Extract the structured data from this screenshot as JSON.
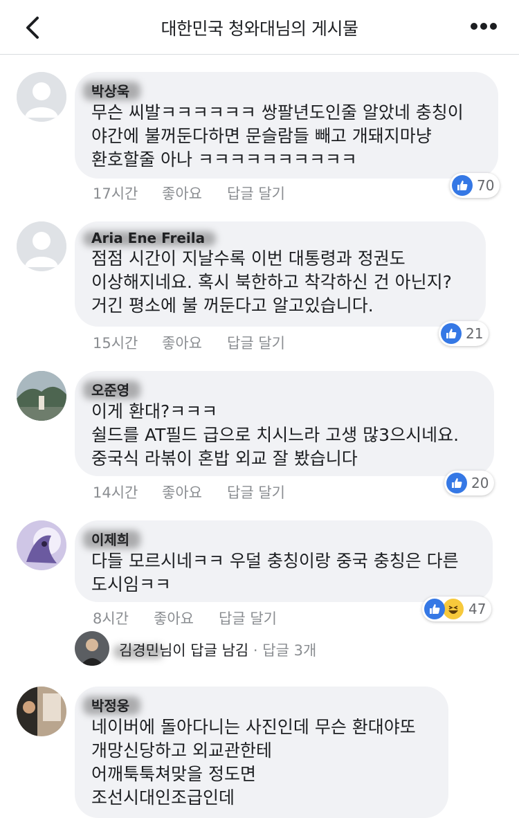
{
  "header": {
    "title": "대한민국 청와대님의 게시물"
  },
  "comments": [
    {
      "author": "박상욱",
      "lines": [
        "무슨 씨발ㅋㅋㅋㅋㅋㅋ 쌍팔년도인줄 알았네 충칭이",
        "야간에 불꺼둔다하면 문슬람들 빼고 개돼지마냥",
        "환호할줄 아나 ㅋㅋㅋㅋㅋㅋㅋㅋㅋㅋ"
      ],
      "time": "17시간",
      "like_label": "좋아요",
      "reply_label": "답글 달기",
      "reaction_count": "70",
      "reactions": [
        "like-icon"
      ]
    },
    {
      "author": "Aria Ene Freila",
      "lines": [
        "점점 시간이 지날수록 이번 대통령과 정권도",
        "이상해지네요. 혹시 북한하고 착각하신 건 아닌지?",
        "거긴 평소에 불 꺼둔다고 알고있습니다."
      ],
      "time": "15시간",
      "like_label": "좋아요",
      "reply_label": "답글 달기",
      "reaction_count": "21",
      "reactions": [
        "like-icon"
      ]
    },
    {
      "author": "오준영",
      "lines": [
        "이게 환대?ㅋㅋㅋ",
        "쉴드를 AT필드 급으로 치시느라 고생 많3으시네요.",
        "중국식 라볶이 혼밥 외교 잘 봤습니다"
      ],
      "time": "14시간",
      "like_label": "좋아요",
      "reply_label": "답글 달기",
      "reaction_count": "20",
      "reactions": [
        "like-icon"
      ]
    },
    {
      "author": "이제희",
      "lines": [
        "다들 모르시네ㅋㅋ 우덜 충칭이랑 중국 충칭은 다른",
        "도시임ㅋㅋ"
      ],
      "time": "8시간",
      "like_label": "좋아요",
      "reply_label": "답글 달기",
      "reaction_count": "47",
      "reactions": [
        "like-icon",
        "haha-icon"
      ]
    },
    {
      "author": "박정웅",
      "lines": [
        "네이버에 돌아다니는 사진인데 무슨 환대야또",
        "개망신당하고 외교관한테",
        "어깨툭툭쳐맞을 정도면",
        "조선시대인조급인데"
      ]
    }
  ],
  "reply_summary": {
    "name": "김경민",
    "suffix": "님이 답글 남김",
    "separator": " · ",
    "count": "답글 3개"
  },
  "colors": {
    "like_blue": "#3578e5",
    "bubble_bg": "#f1f2f5",
    "meta_gray": "#8a8d91"
  }
}
